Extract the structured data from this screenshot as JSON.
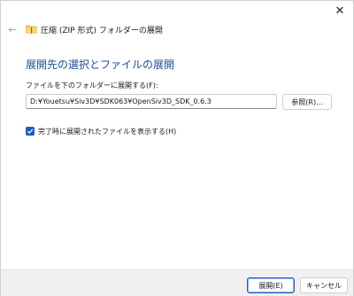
{
  "window": {
    "title": "圧縮 (ZIP 形式) フォルダーの展開"
  },
  "main": {
    "heading": "展開先の選択とファイルの展開",
    "destination_label": "ファイルを下のフォルダーに展開する(F):",
    "destination_value": "D:¥Youetsu¥Siv3D¥SDK063¥OpenSiv3D_SDK_0.6.3",
    "browse_label": "参照(R)...",
    "show_files_label": "完了時に展開されたファイルを表示する(H)",
    "show_files_checked": true
  },
  "footer": {
    "extract_label": "展開(E)",
    "cancel_label": "キャンセル"
  },
  "icons": {
    "close": "close-icon",
    "back": "back-arrow-icon",
    "folder": "zip-folder-icon",
    "check": "checkmark-icon"
  },
  "colors": {
    "accent": "#1f5fbf",
    "heading": "#1f4e96",
    "footer_bg": "#f0f0f0"
  }
}
